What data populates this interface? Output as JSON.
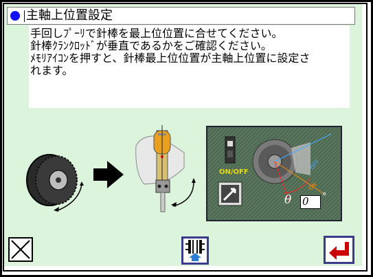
{
  "title": "主軸上位置設定",
  "message_lines": [
    "手回しﾌﾟｰﾘで針棒を最上位位置に合せてください。",
    "針棒ｸﾗﾝｸﾛｯﾄﾞが垂直であるかをご確認ください。",
    "ﾒﾓﾘｱｲｺﾝを押すと、針棒最上位位置が主軸上位置に設定さ",
    "れます。"
  ],
  "diagram": {
    "on_off_label": "ON/OFF",
    "theta_label": "θ",
    "theta_value": "0",
    "degree_symbol": "°"
  },
  "buttons": {
    "close_icon": "close-x-icon",
    "memory_icon": "memory-store-icon",
    "enter_icon": "enter-return-icon"
  },
  "colors": {
    "panel": "#dcf4dc",
    "title_dot": "#1010ff",
    "enter_arrow": "#cc0000",
    "memory_arrow": "#2a7fd4"
  }
}
